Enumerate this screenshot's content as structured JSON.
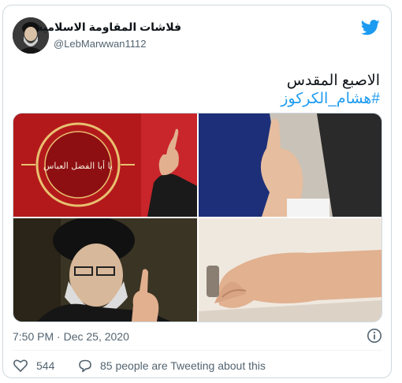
{
  "tweet": {
    "author_name": "فلاشات المقاومة الاسلامية",
    "author_handle": "@LebMarwwan1112",
    "text_line1": "الاصبع المقدس",
    "hashtag": "#هشام_الكركوز",
    "timestamp": "7:50 PM · Dec 25, 2020",
    "likes": "544",
    "replies_text": "85 people are Tweeting about this"
  },
  "media": {
    "image_count": 4,
    "banner_calligraphy": "يا أبا الفضل العباس"
  },
  "icons": {
    "logo": "twitter-bird-icon",
    "info": "info-icon",
    "like": "heart-icon",
    "reply": "reply-bubble-icon"
  },
  "colors": {
    "accent": "#1d9bf0",
    "secondary_text": "#536471",
    "border": "#cfd9de"
  }
}
